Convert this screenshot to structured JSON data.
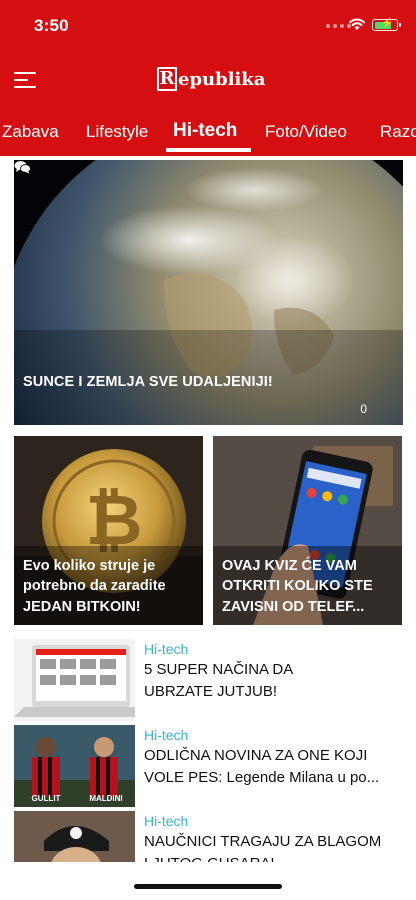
{
  "status_bar": {
    "time": "3:50",
    "battery_percent": 80
  },
  "header": {
    "logo_letter": "R",
    "logo_text": "epublika"
  },
  "tabs": [
    {
      "label": "Zabava"
    },
    {
      "label": "Lifestyle"
    },
    {
      "label": "Hi-tech",
      "active": true
    },
    {
      "label": "Foto/Video"
    },
    {
      "label": "Razo"
    }
  ],
  "hero": {
    "title": "SUNCE I ZEMLJA SVE UDALJENIJI!",
    "comments": "0"
  },
  "cards": [
    {
      "line1": "Evo koliko struje je",
      "line2": "potrebno da zaradite",
      "line3": "JEDAN BITKOIN!"
    },
    {
      "line1": "OVAJ KVIZ ĆE VAM",
      "line2": "OTKRITI KOLIKO STE",
      "line3": "ZAVISNI OD TELEF..."
    }
  ],
  "list": [
    {
      "category": "Hi-tech",
      "line1": "5 SUPER NAČINA DA",
      "line2": "UBRZATE JUTJUB!"
    },
    {
      "category": "Hi-tech",
      "line1": "ODLIČNA NOVINA ZA ONE KOJI",
      "line2": "VOLE PES: Legende Milana u po...",
      "thumb_text_1": "GULLIT",
      "thumb_text_2": "MALDINI"
    },
    {
      "category": "Hi-tech",
      "line1": "NAUČNICI TRAGAJU ZA BLAGOM",
      "line2": "LJUTOG GUSARA!"
    }
  ],
  "colors": {
    "brand_red": "#d50f11",
    "category_teal": "#35b6c9"
  }
}
